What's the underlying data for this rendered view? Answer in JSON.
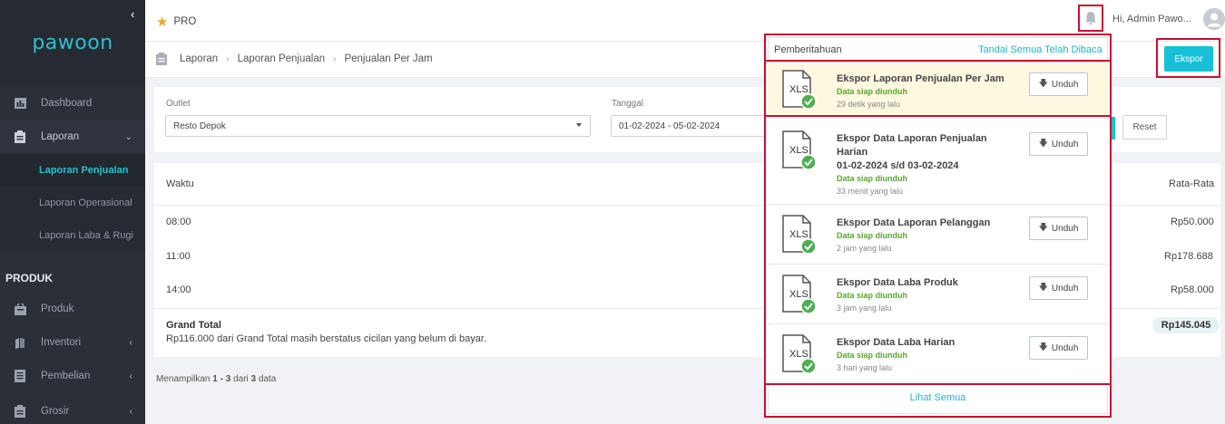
{
  "sidebar": {
    "logo": "pawoon",
    "collapse_icon": "chevron-left-icon",
    "items": [
      {
        "label": "Dashboard",
        "icon": "chart-icon"
      },
      {
        "label": "Laporan",
        "icon": "clipboard-icon"
      }
    ],
    "laporan_subitems": [
      "Laporan Penjualan",
      "Laporan Operasional",
      "Laporan Laba & Rugi"
    ],
    "section_produk": "PRODUK",
    "produk_items": [
      {
        "label": "Produk",
        "icon": "bag-icon"
      },
      {
        "label": "Inventori",
        "icon": "boxes-icon"
      },
      {
        "label": "Pembelian",
        "icon": "document-icon"
      },
      {
        "label": "Grosir",
        "icon": "clipboard-icon"
      }
    ]
  },
  "topbar": {
    "plan": "PRO",
    "greeting": "Hi, Admin Pawo..."
  },
  "breadcrumb": [
    "Laporan",
    "Laporan Penjualan",
    "Penjualan Per Jam"
  ],
  "export_button": "Ekspor",
  "filters": {
    "outlet_label": "Outlet",
    "outlet_value": "Resto Depok",
    "date_label": "Tanggal",
    "date_value": "01-02-2024 - 05-02-2024",
    "reset_label": "Reset"
  },
  "table": {
    "col_time": "Waktu",
    "col_avg": "Rata-Rata",
    "rows": [
      {
        "time": "08:00",
        "avg": "Rp50.000"
      },
      {
        "time": "11:00",
        "avg": "Rp178.688"
      },
      {
        "time": "14:00",
        "avg": "Rp58.000"
      }
    ],
    "grand_total_label": "Grand Total",
    "grand_total_note": "Rp116.000 dari Grand Total masih berstatus cicilan yang belum di bayar.",
    "grand_total_value": "Rp145.045"
  },
  "paging": {
    "prefix": "Menampilkan",
    "from": "1",
    "dash": "-",
    "to": "3",
    "of": "dari",
    "total": "3",
    "suffix": "data"
  },
  "notifications": {
    "title": "Pemberitahuan",
    "mark_all": "Tandai Semua Telah Dibaca",
    "file_tag": "XLS",
    "download_label": "Unduh",
    "items": [
      {
        "name": "Ekspor Laporan Penjualan Per Jam",
        "status": "Data siap diunduh",
        "time": "29 detik yang lalu"
      },
      {
        "name": "Ekspor Data Laporan Penjualan Harian",
        "date_range": "01-02-2024 s/d 03-02-2024",
        "status": "Data siap diunduh",
        "time": "33 menit yang lalu"
      },
      {
        "name": "Ekspor Data Laporan Pelanggan",
        "status": "Data siap diunduh",
        "time": "2 jam yang lalu"
      },
      {
        "name": "Ekspor Data Laba Produk",
        "status": "Data siap diunduh",
        "time": "3 jam yang lalu"
      },
      {
        "name": "Ekspor Data Laba Harian",
        "status": "Data siap diunduh",
        "time": "3 hari yang lalu"
      }
    ],
    "see_all": "Lihat Semua"
  },
  "colors": {
    "accent": "#17c0d7",
    "highlight_border": "#c8102e",
    "sidebar_bg": "#2a2f38",
    "status_green": "#5aa62f"
  }
}
